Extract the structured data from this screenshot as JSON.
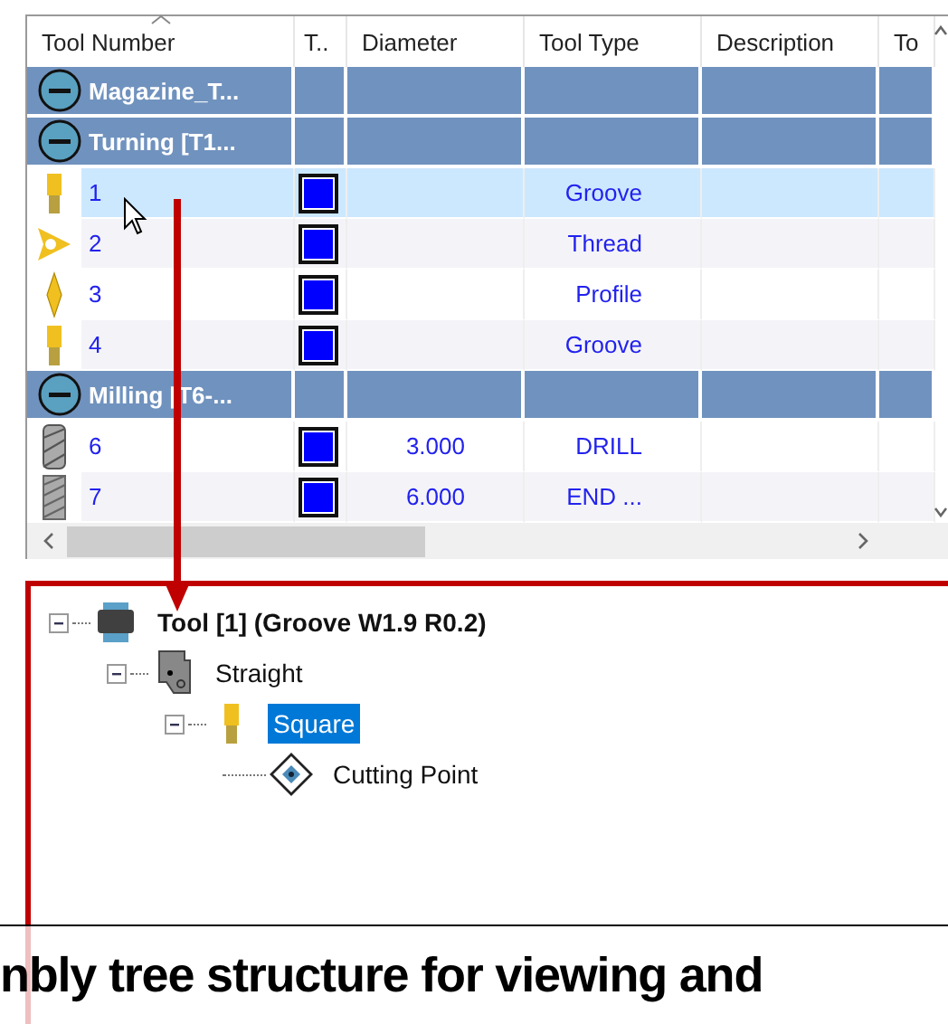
{
  "table": {
    "columns": [
      "Tool Number",
      "T..",
      "Diameter",
      "Tool Type",
      "Description",
      "To"
    ],
    "rows": [
      {
        "kind": "group",
        "label": "Magazine_T..."
      },
      {
        "kind": "group",
        "label": "Turning [T1..."
      },
      {
        "kind": "groove",
        "number": "1",
        "color": "#0000ff",
        "diameter": "",
        "type": "Groove",
        "selected": true
      },
      {
        "kind": "thread",
        "number": "2",
        "color": "#0000ff",
        "diameter": "",
        "type": "Thread",
        "selected": false
      },
      {
        "kind": "profile",
        "number": "3",
        "color": "#0000ff",
        "diameter": "",
        "type": "Profile",
        "selected": false
      },
      {
        "kind": "groove",
        "number": "4",
        "color": "#0000ff",
        "diameter": "",
        "type": "Groove",
        "selected": false
      },
      {
        "kind": "group",
        "label": "Milling [T6-..."
      },
      {
        "kind": "drill",
        "number": "6",
        "color": "#0000ff",
        "diameter": "3.000",
        "type": "DRILL",
        "selected": false
      },
      {
        "kind": "endmill",
        "number": "7",
        "color": "#0000ff",
        "diameter": "6.000",
        "type": "END ...",
        "selected": false
      }
    ]
  },
  "tree": [
    {
      "label": "Tool [1] (Groove W1.9 R0.2)",
      "kind": "tool",
      "expanded": true,
      "selected": false,
      "children": [
        {
          "label": "Straight",
          "kind": "holder",
          "expanded": true,
          "selected": false,
          "children": [
            {
              "label": "Square",
              "kind": "groove",
              "expanded": true,
              "selected": true,
              "children": [
                {
                  "label": "Cutting Point",
                  "kind": "point",
                  "selected": false
                }
              ]
            }
          ]
        }
      ]
    }
  ],
  "caption": "nbly tree structure for viewing and"
}
